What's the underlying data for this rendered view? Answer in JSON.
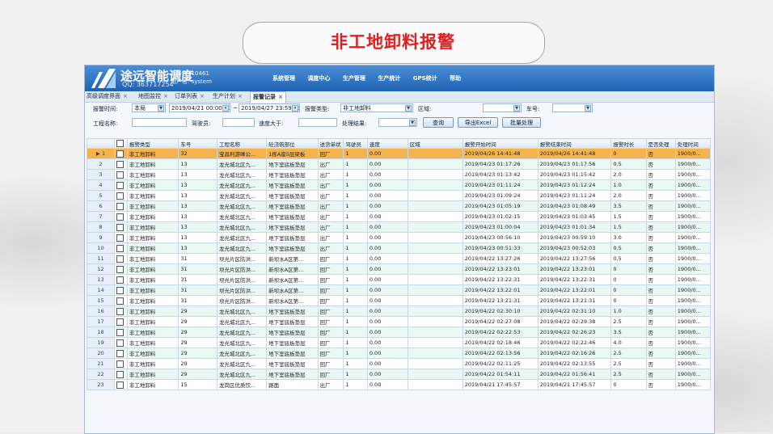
{
  "slide": {
    "title": "非工地卸料报警"
  },
  "app": {
    "name": "途远智能调度",
    "qq": "QQ: 363717254",
    "server_label": "服务名: 10461",
    "user_label": "用户名: system",
    "menu": [
      "系统管理",
      "调度中心",
      "生产管理",
      "生产统计",
      "GPS统计",
      "帮助"
    ]
  },
  "tabs": [
    "高级调度界面",
    "地图监控",
    "订单列表",
    "生产计划",
    "报警记录"
  ],
  "filter": {
    "time_label": "报警时间:",
    "scope_value": "本局",
    "start_time": "2019/04/21 00:00:00",
    "end_time": "2019/04/27 23:59:59",
    "type_label": "报警类型:",
    "type_value": "非工地卸料",
    "region_label": "区域:",
    "vehicle_label": "车号:",
    "project_label": "工程名称:",
    "driver_label": "驾驶员:",
    "speed_label": "速度大于:",
    "result_label": "处理结果:",
    "query_button": "查询",
    "export_button": "导出Excel",
    "batch_button": "批量处理"
  },
  "table": {
    "columns": [
      "",
      "",
      "报警类型",
      "车号",
      "工程名称",
      "砼浇筑部位",
      "送货单状",
      "驾驶员",
      "速度",
      "区域",
      "报警开始时间",
      "报警结束时间",
      "报警时长",
      "是否处理",
      "处理时间"
    ],
    "rows": [
      [
        "1",
        "非工地卸料",
        "32",
        "宝昌利游峰公...",
        "1栋A座5层梁板",
        "回厂",
        "1",
        "0.00",
        "",
        "2019/04/26 14:41:48",
        "2019/04/26 14:41:48",
        "0",
        "否",
        "1900/0..."
      ],
      [
        "2",
        "非工地卸料",
        "13",
        "龙光城北区九...",
        "地下室底板垫层",
        "出厂",
        "1",
        "0.00",
        "",
        "2019/04/23 01:17:26",
        "2019/04/23 01:17:56",
        "0.5",
        "否",
        "1900/0..."
      ],
      [
        "3",
        "非工地卸料",
        "13",
        "龙光城北区九...",
        "地下室底板垫层",
        "出厂",
        "1",
        "0.00",
        "",
        "2019/04/23 01:13:42",
        "2019/04/23 01:15:42",
        "2.0",
        "否",
        "1900/0..."
      ],
      [
        "4",
        "非工地卸料",
        "13",
        "龙光城北区九...",
        "地下室底板垫层",
        "出厂",
        "1",
        "0.00",
        "",
        "2019/04/23 01:11:24",
        "2019/04/23 01:12:24",
        "1.0",
        "否",
        "1900/0..."
      ],
      [
        "5",
        "非工地卸料",
        "13",
        "龙光城北区九...",
        "地下室底板垫层",
        "出厂",
        "1",
        "0.00",
        "",
        "2019/04/23 01:09:24",
        "2019/04/23 01:11:24",
        "2.0",
        "否",
        "1900/0..."
      ],
      [
        "6",
        "非工地卸料",
        "13",
        "龙光城北区九...",
        "地下室底板垫层",
        "出厂",
        "1",
        "0.00",
        "",
        "2019/04/23 01:05:19",
        "2019/04/23 01:08:49",
        "3.5",
        "否",
        "1900/0..."
      ],
      [
        "7",
        "非工地卸料",
        "13",
        "龙光城北区九...",
        "地下室底板垫层",
        "出厂",
        "1",
        "0.00",
        "",
        "2019/04/23 01:02:15",
        "2019/04/23 01:03:45",
        "1.5",
        "否",
        "1900/0..."
      ],
      [
        "8",
        "非工地卸料",
        "13",
        "龙光城北区九...",
        "地下室底板垫层",
        "出厂",
        "1",
        "0.00",
        "",
        "2019/04/23 01:00:04",
        "2019/04/23 01:01:34",
        "1.5",
        "否",
        "1900/0..."
      ],
      [
        "9",
        "非工地卸料",
        "13",
        "龙光城北区九...",
        "地下室底板垫层",
        "出厂",
        "1",
        "0.00",
        "",
        "2019/04/23 00:56:10",
        "2019/04/23 00:59:10",
        "3.0",
        "否",
        "1900/0..."
      ],
      [
        "10",
        "非工地卸料",
        "13",
        "龙光城北区九...",
        "地下室底板垫层",
        "出厂",
        "1",
        "0.00",
        "",
        "2019/04/23 00:51:33",
        "2019/04/23 00:52:03",
        "0.5",
        "否",
        "1900/0..."
      ],
      [
        "11",
        "非工地卸料",
        "31",
        "坝光片区防洪...",
        "新坝水A区第...",
        "回厂",
        "1",
        "0.00",
        "",
        "2019/04/22 13:27:26",
        "2019/04/22 13:27:56",
        "0.5",
        "否",
        "1900/0..."
      ],
      [
        "12",
        "非工地卸料",
        "31",
        "坝光片区防洪...",
        "新坝水A区第...",
        "回厂",
        "1",
        "0.00",
        "",
        "2019/04/22 13:23:01",
        "2019/04/22 13:23:01",
        "0",
        "否",
        "1900/0..."
      ],
      [
        "13",
        "非工地卸料",
        "31",
        "坝光片区防洪...",
        "新坝水A区第...",
        "回厂",
        "1",
        "0.00",
        "",
        "2019/04/22 13:22:31",
        "2019/04/22 13:22:31",
        "0",
        "否",
        "1900/0..."
      ],
      [
        "14",
        "非工地卸料",
        "31",
        "坝光片区防洪...",
        "新坝水A区第...",
        "回厂",
        "1",
        "0.00",
        "",
        "2019/04/22 13:22:01",
        "2019/04/22 13:22:01",
        "0",
        "否",
        "1900/0..."
      ],
      [
        "15",
        "非工地卸料",
        "31",
        "坝光片区防洪...",
        "新坝水A区第...",
        "回厂",
        "1",
        "0.00",
        "",
        "2019/04/22 13:21:31",
        "2019/04/22 13:21:31",
        "0",
        "否",
        "1900/0..."
      ],
      [
        "16",
        "非工地卸料",
        "29",
        "龙光城北区九...",
        "地下室底板垫层",
        "回厂",
        "1",
        "0.00",
        "",
        "2019/04/22 02:30:10",
        "2019/04/22 02:31:10",
        "1.0",
        "否",
        "1900/0..."
      ],
      [
        "17",
        "非工地卸料",
        "29",
        "龙光城北区九...",
        "地下室底板垫层",
        "回厂",
        "1",
        "0.00",
        "",
        "2019/04/22 02:27:08",
        "2019/04/22 02:29:38",
        "2.5",
        "否",
        "1900/0..."
      ],
      [
        "18",
        "非工地卸料",
        "29",
        "龙光城北区九...",
        "地下室底板垫层",
        "回厂",
        "1",
        "0.00",
        "",
        "2019/04/22 02:22:53",
        "2019/04/22 02:26:23",
        "3.5",
        "否",
        "1900/0..."
      ],
      [
        "19",
        "非工地卸料",
        "29",
        "龙光城北区九...",
        "地下室底板垫层",
        "回厂",
        "1",
        "0.00",
        "",
        "2019/04/22 02:18:46",
        "2019/04/22 02:22:46",
        "4.0",
        "否",
        "1900/0..."
      ],
      [
        "20",
        "非工地卸料",
        "29",
        "龙光城北区九...",
        "地下室底板垫层",
        "回厂",
        "1",
        "0.00",
        "",
        "2019/04/22 02:13:56",
        "2019/04/22 02:16:26",
        "2.5",
        "否",
        "1900/0..."
      ],
      [
        "21",
        "非工地卸料",
        "29",
        "龙光城北区九...",
        "地下室底板垫层",
        "回厂",
        "1",
        "0.00",
        "",
        "2019/04/22 02:11:25",
        "2019/04/22 02:13:55",
        "2.5",
        "否",
        "1900/0..."
      ],
      [
        "22",
        "非工地卸料",
        "29",
        "龙光城北区九...",
        "地下室底板垫层",
        "回厂",
        "1",
        "0.00",
        "",
        "2019/04/22 01:54:11",
        "2019/04/22 01:56:41",
        "2.5",
        "否",
        "1900/0..."
      ],
      [
        "23",
        "非工地卸料",
        "15",
        "龙岗区优质饮...",
        "路面",
        "出厂",
        "1",
        "0.00",
        "",
        "2019/04/21 17:45:57",
        "2019/04/21 17:45:57",
        "0",
        "否",
        "1900/0..."
      ]
    ]
  }
}
